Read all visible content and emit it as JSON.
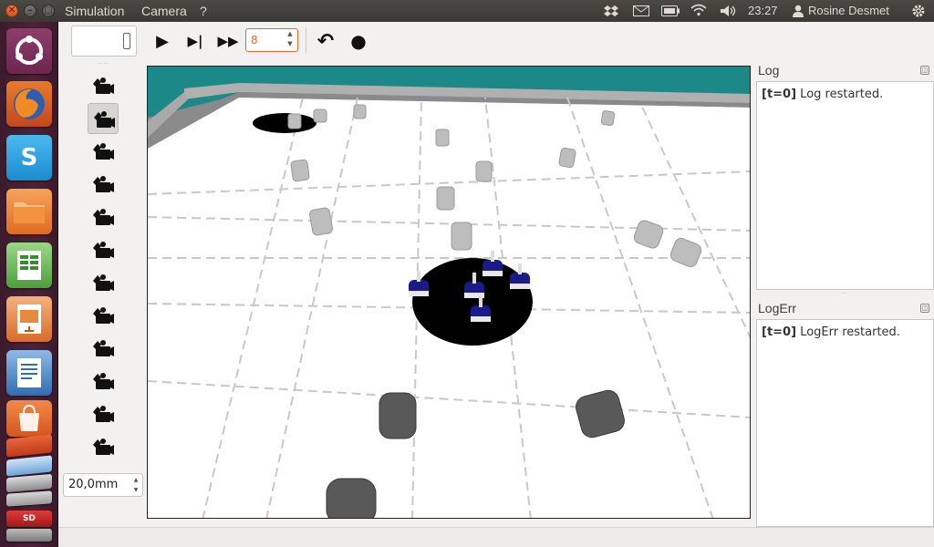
{
  "topbar": {
    "menus": [
      "Simulation",
      "Camera",
      "?"
    ],
    "time": "23:27",
    "user": "Rosine Desmet",
    "indicators": [
      "dropbox-icon",
      "mail-icon",
      "battery-icon",
      "wifi-icon",
      "volume-icon"
    ]
  },
  "launcher": {
    "apps": [
      "ubuntu-dash",
      "firefox",
      "skype",
      "files",
      "calc",
      "impress",
      "writer",
      "software-center",
      "stack"
    ]
  },
  "toolbar": {
    "frame_value": "8",
    "play_icon": "▶",
    "step_icon": "▶|",
    "fast_icon": "▶▶",
    "reset_icon": "↶",
    "record_icon": "●"
  },
  "camera_panel": {
    "camera_count": 12,
    "selected_index": 1,
    "zoom_value": "20,0mm"
  },
  "log": {
    "title": "Log",
    "tag": "[t=0]",
    "message": " Log restarted."
  },
  "logerr": {
    "title": "LogErr",
    "tag": "[t=0]",
    "message": " LogErr restarted."
  },
  "colors": {
    "wall": "#1e8a8a",
    "floor": "#ffffff",
    "robot": "#1a1a8a",
    "accent": "#e06c2a"
  }
}
